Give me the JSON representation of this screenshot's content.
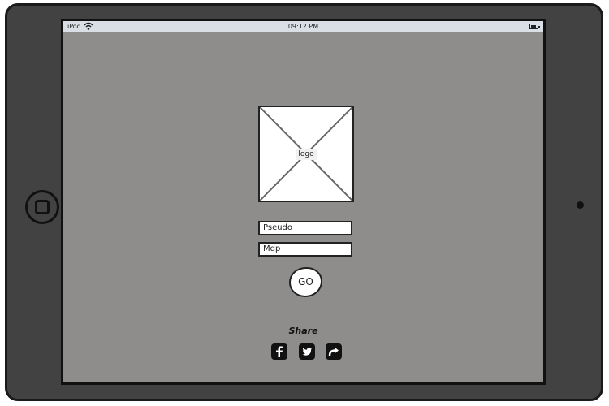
{
  "status_bar": {
    "carrier": "iPod",
    "time": "09:12 PM"
  },
  "logo": {
    "label": "logo"
  },
  "login": {
    "pseudo_placeholder": "Pseudo",
    "mdp_placeholder": "Mdp",
    "go_label": "GO"
  },
  "share": {
    "label": "Share",
    "icons": [
      "facebook-icon",
      "twitter-icon",
      "share-arrow-icon"
    ]
  }
}
